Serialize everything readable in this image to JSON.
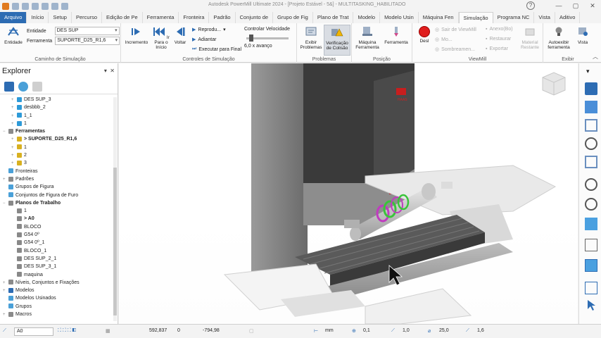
{
  "titlebar": {
    "title": "Autodesk PowerMill Ultimate 2024 - [Projeto Estável - 5&] - MULTITASKING_HABILITADO",
    "help": "?"
  },
  "tabs": [
    "Arquivo",
    "Início",
    "Setup",
    "Percurso",
    "Edição de Pe",
    "Ferramenta",
    "Fronteira",
    "Padrão",
    "Conjunto de",
    "Grupo de Fig",
    "Plano de Trat",
    "Modelo",
    "Modelo Usin",
    "Máquina Fen",
    "Simulação",
    "Programa NC",
    "Vista",
    "Aditivo"
  ],
  "ribbon": {
    "entidade_btn": "Entidade",
    "entidade_label": "Entidade",
    "entidade_value": "DES SUP",
    "ferramenta_label": "Ferramenta",
    "ferramenta_value": "SUPORTE_D25_R1,6",
    "group_caminho": "Caminho de Simulação",
    "incremento": "Incremento",
    "ir_para_inicio": "Ir Para o Início",
    "voltar": "Voltar",
    "reproduzir": "Reprodu...",
    "adiantar": "Adiantar",
    "executar": "Executar para Final",
    "controlar": "Controlar Velocidade",
    "speed": "6,0 x avanço",
    "group_controles": "Controles de Simulação",
    "exibir_problemas": "Exibir Problemas",
    "verificacao": "Verificação de Colisão",
    "group_problemas": "Problemas",
    "maquina_ferramenta": "Máquina Ferramenta",
    "ferramenta_btn": "Ferramenta",
    "group_posicao": "Posição",
    "desl": "Desl",
    "sair_viewmill": "Sair de ViewMill",
    "mo": "Mo...",
    "sombreamen": "Sombreamen...",
    "anexo": "Anexo(Bo)",
    "restaurar": "Restaurar",
    "exportar": "Exportar",
    "material_restante": "Material Restante",
    "group_viewmill": "ViewMill",
    "autoexibir": "Autoexibir ferramenta",
    "vista": "Vista",
    "group_exibir": "Exibir"
  },
  "explorer": {
    "title": "Explorer",
    "rows": [
      {
        "indent": 2,
        "label": "DES SUP_3",
        "icon": "toolpath-icon",
        "exp": "+"
      },
      {
        "indent": 2,
        "label": "desbbb_2",
        "icon": "toolpath-icon",
        "exp": "+"
      },
      {
        "indent": 2,
        "label": "1_1",
        "icon": "toolpath-icon",
        "exp": "+"
      },
      {
        "indent": 2,
        "label": "1",
        "icon": "toolpath-icon",
        "exp": "+"
      },
      {
        "indent": 0,
        "label": "Ferramentas",
        "icon": "folder-icon",
        "exp": "−",
        "bold": true
      },
      {
        "indent": 2,
        "label": "> SUPORTE_D25_R1,6",
        "icon": "tool-icon",
        "exp": "+",
        "bold": true
      },
      {
        "indent": 2,
        "label": "1",
        "icon": "tool-icon",
        "exp": "+"
      },
      {
        "indent": 2,
        "label": "2",
        "icon": "tool-icon",
        "exp": "+"
      },
      {
        "indent": 2,
        "label": "3",
        "icon": "tool-icon",
        "exp": "+"
      },
      {
        "indent": 0,
        "label": "Fronteiras",
        "icon": "boundary-icon",
        "exp": ""
      },
      {
        "indent": 0,
        "label": "Padrões",
        "icon": "pattern-icon",
        "exp": "+"
      },
      {
        "indent": 0,
        "label": "Grupos de Figura",
        "icon": "feature-icon",
        "exp": ""
      },
      {
        "indent": 0,
        "label": "Conjuntos de Figura de Furo",
        "icon": "hole-icon",
        "exp": ""
      },
      {
        "indent": 0,
        "label": "Planos de Trabalho",
        "icon": "workplane-icon",
        "exp": "−",
        "bold": true
      },
      {
        "indent": 2,
        "label": "1",
        "icon": "workplane-icon",
        "exp": ""
      },
      {
        "indent": 2,
        "label": "> A0",
        "icon": "workplane-icon",
        "exp": "",
        "bold": true
      },
      {
        "indent": 2,
        "label": "BLOCO",
        "icon": "workplane-icon",
        "exp": ""
      },
      {
        "indent": 2,
        "label": "G54 0º",
        "icon": "workplane-icon",
        "exp": ""
      },
      {
        "indent": 2,
        "label": "G54 0º_1",
        "icon": "workplane-icon",
        "exp": ""
      },
      {
        "indent": 2,
        "label": "BLOCO_1",
        "icon": "workplane-icon",
        "exp": ""
      },
      {
        "indent": 2,
        "label": "DES SUP_2_1",
        "icon": "workplane-icon",
        "exp": ""
      },
      {
        "indent": 2,
        "label": "DES SUP_3_1",
        "icon": "workplane-icon",
        "exp": ""
      },
      {
        "indent": 2,
        "label": "maquina",
        "icon": "workplane-icon",
        "exp": ""
      },
      {
        "indent": 0,
        "label": "Níveis, Conjuntos e Fixações",
        "icon": "level-icon",
        "exp": "+"
      },
      {
        "indent": 0,
        "label": "Modelos",
        "icon": "model-icon",
        "exp": "+"
      },
      {
        "indent": 0,
        "label": "Modelos Usinados",
        "icon": "machined-icon",
        "exp": ""
      },
      {
        "indent": 0,
        "label": "Grupos",
        "icon": "group-icon",
        "exp": ""
      },
      {
        "indent": 0,
        "label": "Macros",
        "icon": "macro-icon",
        "exp": "+"
      }
    ]
  },
  "viewport": {
    "machine_brand": "HAAS"
  },
  "statusbar": {
    "workplane": "A0",
    "x": "592,837",
    "y": "0",
    "z": "-794,98",
    "units": "mm",
    "tol1": "0,1",
    "tol2": "1,0",
    "dia": "25,0",
    "val": "1,6"
  },
  "colors": {
    "accent": "#2d6cb3",
    "machine_gray": "#8c8c8c",
    "machine_dark": "#3a3a3a",
    "part_green": "#3ac43a",
    "part_magenta": "#c03bc0",
    "stop_red": "#e01e1e"
  }
}
